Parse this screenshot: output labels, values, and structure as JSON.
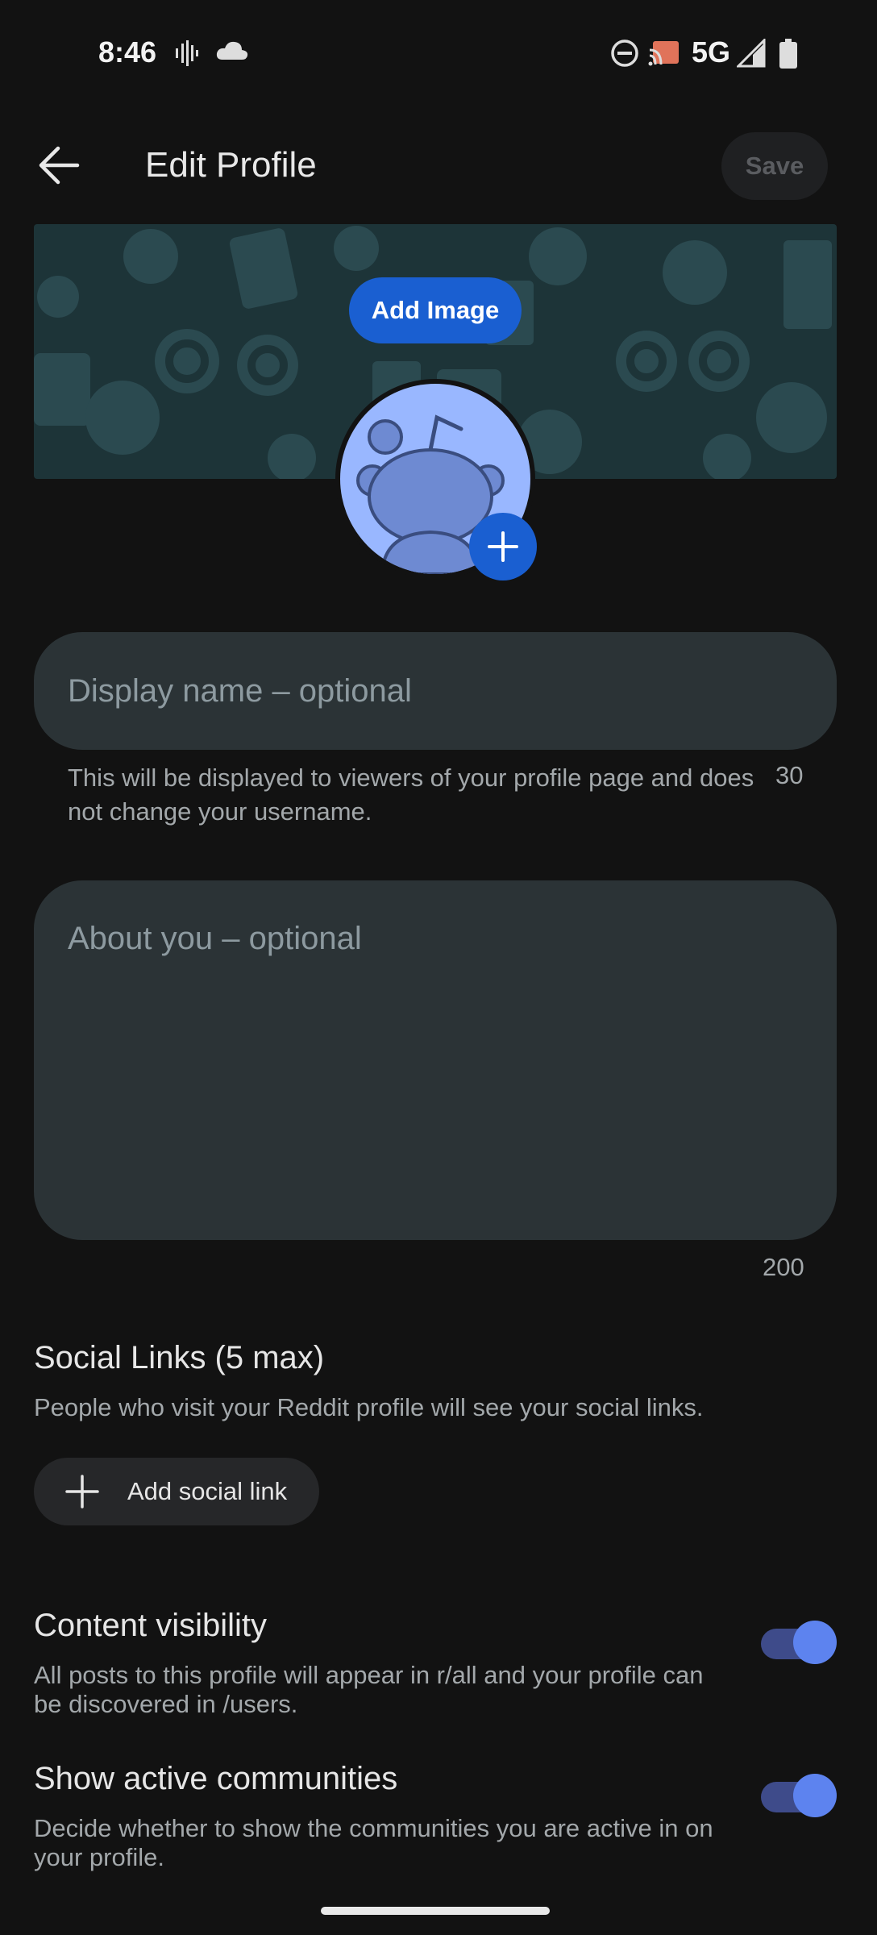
{
  "status_bar": {
    "time": "8:46",
    "network": "5G",
    "icons": [
      "vibrate-icon",
      "cloud-icon",
      "dnd-icon",
      "cast-icon",
      "signal-icon",
      "battery-icon"
    ]
  },
  "header": {
    "title": "Edit Profile",
    "save_label": "Save"
  },
  "banner": {
    "add_image_label": "Add Image"
  },
  "fields": {
    "display_name": {
      "placeholder": "Display name – optional",
      "value": "",
      "helper": "This will be displayed to viewers of your profile page and does not change your username.",
      "remaining": "30"
    },
    "about": {
      "placeholder": "About you – optional",
      "value": "",
      "remaining": "200"
    }
  },
  "social_links": {
    "title": "Social Links (5 max)",
    "description": "People who visit your Reddit profile will see your social links.",
    "add_label": "Add social link"
  },
  "content_visibility": {
    "title": "Content visibility",
    "description": "All posts to this profile will appear in r/all and your profile can be discovered in /users.",
    "enabled": true
  },
  "active_communities": {
    "title": "Show active communities",
    "description": "Decide whether to show the communities you are active in on your profile.",
    "enabled": true
  },
  "colors": {
    "background": "#121212",
    "accent_blue": "#1a5fd1",
    "field_bg": "#2b3336",
    "toggle_track": "#3e4b8a",
    "toggle_knob": "#5d83ef",
    "avatar_bg": "#99b7ff"
  }
}
